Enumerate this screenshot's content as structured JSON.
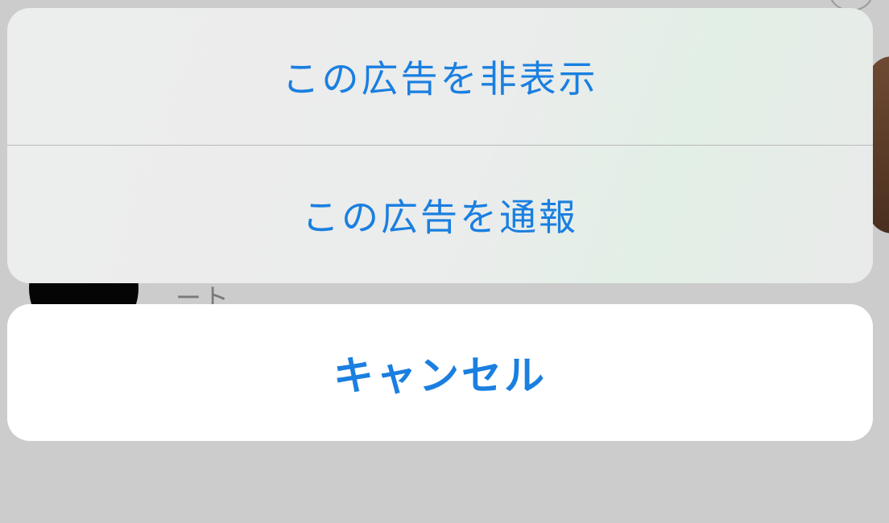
{
  "background": {
    "partial_text": "ート"
  },
  "action_sheet": {
    "actions": [
      {
        "label": "この広告を非表示"
      },
      {
        "label": "この広告を通報"
      }
    ],
    "cancel_label": "キャンセル"
  },
  "colors": {
    "accent": "#1a7fe0",
    "sheet_background": "#ececec",
    "cancel_background": "#ffffff",
    "dim_overlay": "#cccccc"
  }
}
